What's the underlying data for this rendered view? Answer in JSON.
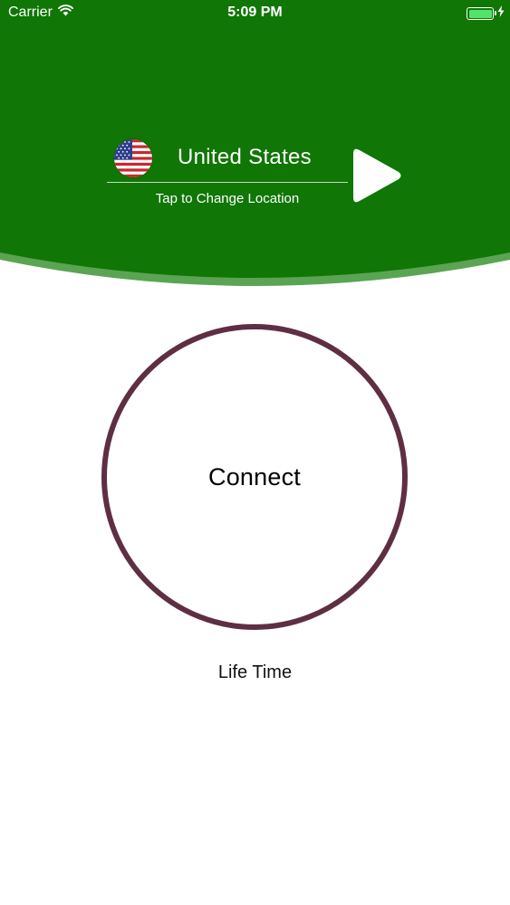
{
  "status_bar": {
    "carrier": "Carrier",
    "time": "5:09 PM",
    "wifi_icon": "wifi-icon",
    "battery_icon": "battery-icon",
    "charging_icon": "bolt-icon"
  },
  "location": {
    "country": "United States",
    "hint": "Tap to Change Location",
    "flag_icon": "us-flag-icon"
  },
  "play_icon": "play-icon",
  "connect": {
    "label": "Connect"
  },
  "plan": {
    "label": "Life Time"
  },
  "colors": {
    "header_green": "#107606",
    "header_edge_green": "#5aa454",
    "ring": "#5e2f43",
    "battery_fill": "#53e26b",
    "background": "#ffffff"
  }
}
